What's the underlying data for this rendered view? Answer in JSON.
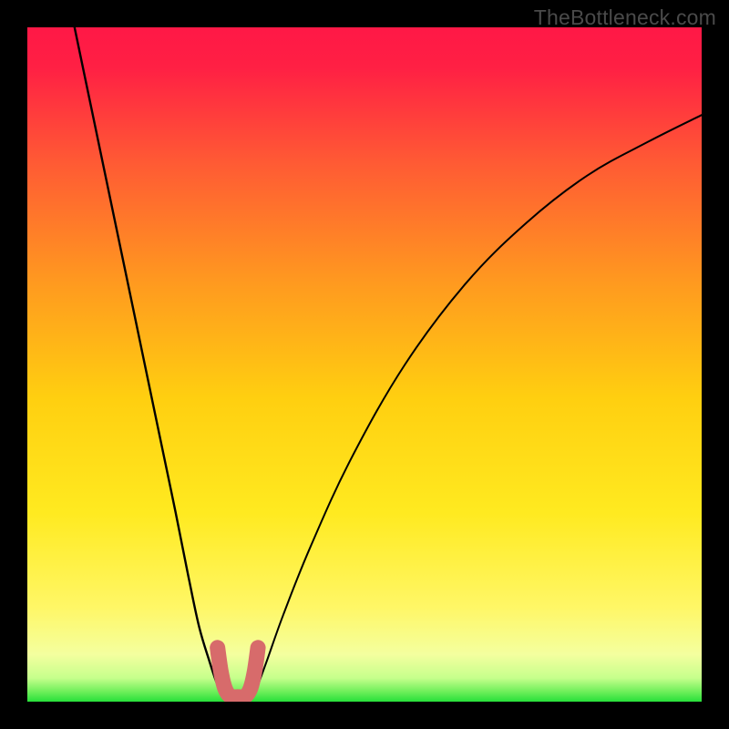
{
  "watermark": "TheBottleneck.com",
  "chart_data": {
    "type": "line",
    "title": "",
    "xlabel": "",
    "ylabel": "",
    "xlim": [
      0,
      100
    ],
    "ylim": [
      0,
      100
    ],
    "grid": false,
    "legend": false,
    "background_gradient": {
      "top_color": "#ff1846",
      "mid_color": "#ffd400",
      "bottom_band_color": "#f8ff9a",
      "bottom_edge_color": "#27e03a"
    },
    "series": [
      {
        "name": "left-curve",
        "stroke": "#000000",
        "x": [
          7,
          9.5,
          12,
          14.5,
          17,
          19.5,
          22,
          24,
          25.5,
          27,
          28,
          28.7,
          29.2
        ],
        "y": [
          100,
          88,
          76,
          64,
          52,
          40,
          28,
          18,
          11,
          6,
          3,
          1.5,
          0.8
        ]
      },
      {
        "name": "right-curve",
        "stroke": "#000000",
        "x": [
          33.3,
          34,
          35.5,
          38,
          42,
          48,
          56,
          65,
          74,
          83,
          92,
          100
        ],
        "y": [
          0.8,
          2,
          6,
          13,
          23,
          36,
          50,
          62,
          71,
          78,
          83,
          87
        ]
      },
      {
        "name": "bottom-arc",
        "stroke": "#d76b6b",
        "x": [
          28.2,
          28.7,
          29.3,
          30.1,
          31.2,
          32.3,
          33.1,
          33.7,
          34.2
        ],
        "y": [
          8,
          4.5,
          2,
          0.8,
          0.7,
          0.8,
          2,
          4.5,
          8
        ]
      }
    ]
  }
}
